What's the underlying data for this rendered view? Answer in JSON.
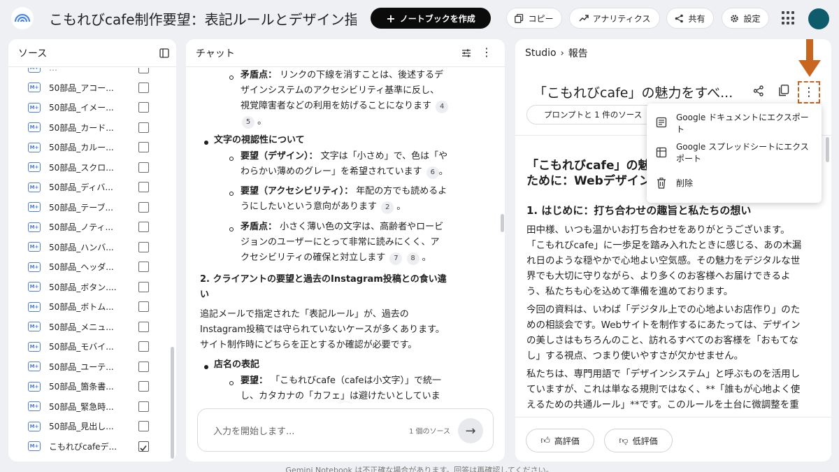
{
  "header": {
    "title": "こもれびcafe制作要望：表記ルールとデザイン指針",
    "create_button": "ノートブックを作成",
    "copy_button": "コピー",
    "analytics_button": "アナリティクス",
    "share_button": "共有",
    "settings_button": "設定"
  },
  "sources": {
    "title": "ソース",
    "items": [
      {
        "label": "50部品_アコー...",
        "checked": false
      },
      {
        "label": "50部品_イメー...",
        "checked": false
      },
      {
        "label": "50部品_カード...",
        "checked": false
      },
      {
        "label": "50部品_カルー...",
        "checked": false
      },
      {
        "label": "50部品_スクロ...",
        "checked": false
      },
      {
        "label": "50部品_ディバ...",
        "checked": false
      },
      {
        "label": "50部品_テーブ...",
        "checked": false
      },
      {
        "label": "50部品_ノティ...",
        "checked": false
      },
      {
        "label": "50部品_ハンバ...",
        "checked": false
      },
      {
        "label": "50部品_ヘッダ...",
        "checked": false
      },
      {
        "label": "50部品_ボタン....",
        "checked": false
      },
      {
        "label": "50部品_ボトム...",
        "checked": false
      },
      {
        "label": "50部品_メニュ...",
        "checked": false
      },
      {
        "label": "50部品_モバイ...",
        "checked": false
      },
      {
        "label": "50部品_ユーテ...",
        "checked": false
      },
      {
        "label": "50部品_箇条書...",
        "checked": false
      },
      {
        "label": "50部品_緊急時...",
        "checked": false
      },
      {
        "label": "50部品_見出し...",
        "checked": false
      },
      {
        "label": "こもれびcafeデ...",
        "checked": true
      }
    ]
  },
  "chat": {
    "title": "チャット",
    "b1_label": "矛盾点：",
    "b1_text_a": "リンクの下線を消すことは、後述するデ",
    "b1_text_b": "ザインシステムのアクセシビリティ基準に反し、",
    "b1_text_c": "視覚障害者などの利用を妨げることになります",
    "b1_ref1": "4",
    "b1_ref2": "5",
    "b1_end": "。",
    "sec_visibility": "文字の視認性について",
    "b2_label": "要望（デザイン）：",
    "b2_text_a": "文字は「小さめ」で、色は「や",
    "b2_text_b": "わらかい薄めのグレー」を希望されています",
    "b2_ref": "6",
    "b2_end": "。",
    "b3_label": "要望（アクセシビリティ）：",
    "b3_text_a": "年配の方でも読めるよ",
    "b3_text_b": "うにしたいという意向があります",
    "b3_ref": "2",
    "b3_end": "。",
    "b4_label": "矛盾点：",
    "b4_text_a": "小さく薄い色の文字は、高齢者やロービ",
    "b4_text_b": "ジョンのユーザーにとって非常に読みにくく、ア",
    "b4_text_c": "クセシビリティの確保と対立します",
    "b4_ref1": "7",
    "b4_ref2": "8",
    "b4_end": "。",
    "heading2_a": "2. クライアントの要望と過去のInstagram投稿との食い違",
    "heading2_b": "い",
    "para_a": "追記メールで指定された「表記ルール」が、過去の",
    "para_b": "Instagram投稿では守られていないケースが多くあります。",
    "para_c": "サイト制作時にどちらを正とするか確認が必要です。",
    "sec_store": "店名の表記",
    "b5_label": "要望：",
    "b5_text_a": "「こもれびcafe（cafeは小文字）」で統一",
    "b5_text_b": "し、カタカナの「カフェ」は避けたいとしていま",
    "input_placeholder": "入力を開始します...",
    "source_count": "1 個のソース"
  },
  "studio": {
    "breadcrumb_root": "Studio",
    "breadcrumb_current": "報告",
    "report_title": "「こもれびcafe」の魅力をすべ...",
    "chip": "プロンプトと 1 件のソース",
    "h_a": "「こもれびcafe」の魅",
    "h_b": "ために：Webデザイン",
    "h1": "1. はじめに：打ち合わせの趣旨と私たちの想い",
    "p1_a": "田中様、いつも温かいお打ち合わせをありがとうございます。",
    "p1_b": "「こもれびcafe」に一歩足を踏み入れたときに感じる、あの木漏",
    "p1_c": "れ日のような穏やかで心地よい空気感。その魅力をデジタルな世",
    "p1_d": "界でも大切に守りながら、より多くのお客様へお届けできるよ",
    "p1_e": "う、私たちも心を込めて準備を進めております。",
    "p2_a": "今回の資料は、いわば「デジタル上での心地よいお店作り」のた",
    "p2_b": "めの相談会です。Webサイトを制作するにあたっては、デザイン",
    "p2_c": "の美しさはもちろんのこと、訪れるすべてのお客様を「おもてな",
    "p2_d": "し」する視点、つまり使いやすさが欠かせません。",
    "p3_a": "私たちは、専門用語で「デザインシステム」と呼ぶものを活用し",
    "p3_b": "ていますが、これは単なる規則ではなく、**「誰もが心地よく使",
    "p3_c": "えるための共通ルール」**です。このルールを土台に微調整を重",
    "like_button": "高評価",
    "dislike_button": "低評価",
    "menu": {
      "export_docs": "Google ドキュメントにエクスポート",
      "export_sheets": "Google スプレッドシートにエクスポート",
      "delete": "削除"
    }
  },
  "footer": "Gemini Notebook は不正確な場合があります。回答は再確認してください。",
  "colors": {
    "annotation": "#c8651f",
    "accent_dark": "#0b0b0b",
    "source_icon": "#4f7fd9",
    "avatar": "#0e5b6b"
  }
}
